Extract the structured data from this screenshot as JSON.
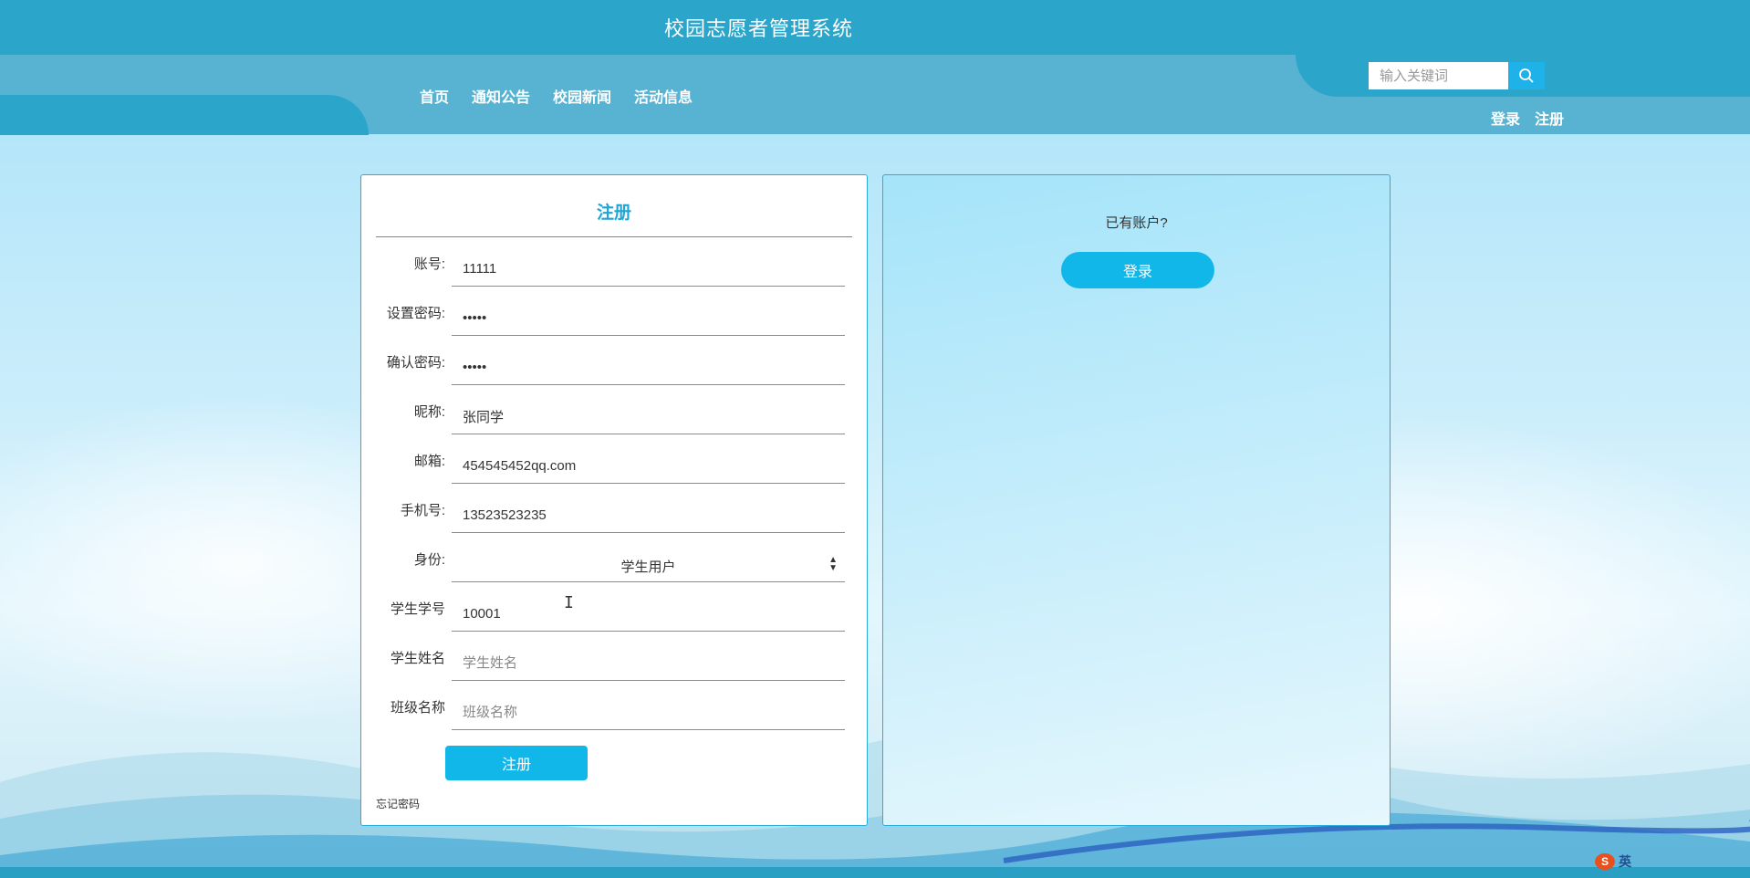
{
  "header": {
    "site_title": "校园志愿者管理系统",
    "nav": [
      "首页",
      "通知公告",
      "校园新闻",
      "活动信息"
    ],
    "search_placeholder": "输入关键词",
    "login_link": "登录",
    "register_link": "注册"
  },
  "register_form": {
    "title": "注册",
    "fields": [
      {
        "label": "账号:",
        "value": "11111",
        "placeholder": "",
        "type": "text"
      },
      {
        "label": "设置密码:",
        "value": "11111",
        "placeholder": "",
        "type": "password"
      },
      {
        "label": "确认密码:",
        "value": "11111",
        "placeholder": "",
        "type": "password"
      },
      {
        "label": "昵称:",
        "value": "张同学",
        "placeholder": "",
        "type": "text"
      },
      {
        "label": "邮箱:",
        "value": "454545452qq.com",
        "placeholder": "",
        "type": "text"
      },
      {
        "label": "手机号:",
        "value": "13523523235",
        "placeholder": "",
        "type": "text"
      },
      {
        "label": "身份:",
        "value": "学生用户",
        "type": "select"
      },
      {
        "label": "学生学号",
        "value": "10001",
        "placeholder": "",
        "type": "text"
      },
      {
        "label": "学生姓名",
        "value": "",
        "placeholder": "学生姓名",
        "type": "text"
      },
      {
        "label": "班级名称",
        "value": "",
        "placeholder": "班级名称",
        "type": "text"
      }
    ],
    "submit_label": "注册",
    "forgot_password": "忘记密码"
  },
  "login_panel": {
    "prompt": "已有账户?",
    "login_button": "登录"
  },
  "watermark": {
    "ime_label": "英"
  },
  "colors": {
    "header": "#2ca5cb",
    "nav_band": "#58b3d3",
    "accent": "#12b7ea",
    "border": "#29aedb"
  }
}
